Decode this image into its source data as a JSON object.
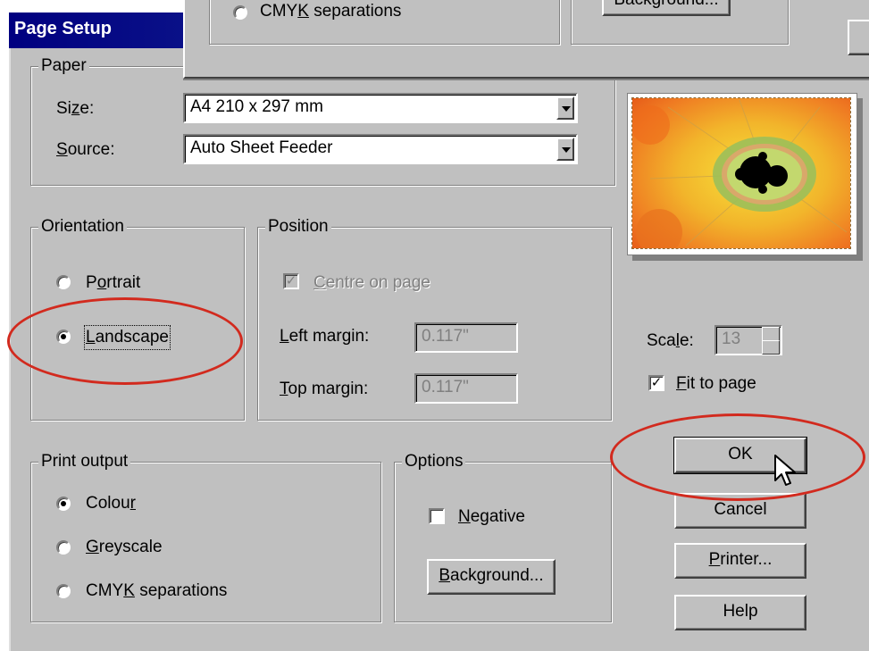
{
  "window": {
    "title": "Page Setup"
  },
  "overlay_window": {
    "radio_label": "CMYK separations",
    "radio_mnemonic_before": "CMY",
    "radio_mnemonic_key": "K",
    "radio_mnemonic_after": " separations",
    "button_label": "Background..."
  },
  "paper": {
    "legend": "Paper",
    "size_label_before": "Si",
    "size_label_key": "z",
    "size_label_after": "e:",
    "size_value": "A4 210 x 297 mm",
    "source_label_key": "S",
    "source_label_after": "ource:",
    "source_value": "Auto Sheet Feeder"
  },
  "orientation": {
    "legend": "Orientation",
    "portrait_before": "P",
    "portrait_key": "o",
    "portrait_after": "rtrait",
    "landscape_key": "L",
    "landscape_after": "andscape",
    "selected": "Landscape"
  },
  "position": {
    "legend": "Position",
    "centre_key": "C",
    "centre_after": "entre on page",
    "centre_checked": true,
    "left_margin_key": "L",
    "left_margin_after": "eft margin:",
    "left_margin_value": "0.117\"",
    "top_margin_key": "T",
    "top_margin_after": "op margin:",
    "top_margin_value": "0.117\""
  },
  "scale": {
    "label_before": "Sca",
    "label_key": "l",
    "label_after": "e:",
    "value": "13",
    "fit_key": "F",
    "fit_after": "it to page",
    "fit_checked": true
  },
  "print_output": {
    "legend": "Print output",
    "colour_before": "Colou",
    "colour_key": "r",
    "greyscale_key": "G",
    "greyscale_after": "reyscale",
    "cmyk_before": "CMY",
    "cmyk_key": "K",
    "cmyk_after": " separations",
    "selected": "Colour"
  },
  "options": {
    "legend": "Options",
    "negative_key": "N",
    "negative_after": "egative",
    "negative_checked": false,
    "background_key": "B",
    "background_after": "ackground..."
  },
  "buttons": {
    "ok": "OK",
    "cancel": "Cancel",
    "printer_key": "P",
    "printer_after": "rinter...",
    "help": "Help"
  },
  "colors": {
    "dialog_face": "#c0c0c0",
    "titlebar": "#000080",
    "highlight_ellipse": "#d22a1e"
  },
  "icons": {
    "cursor": "arrow-cursor-icon",
    "preview": "mandelbrot-fractal-image"
  }
}
